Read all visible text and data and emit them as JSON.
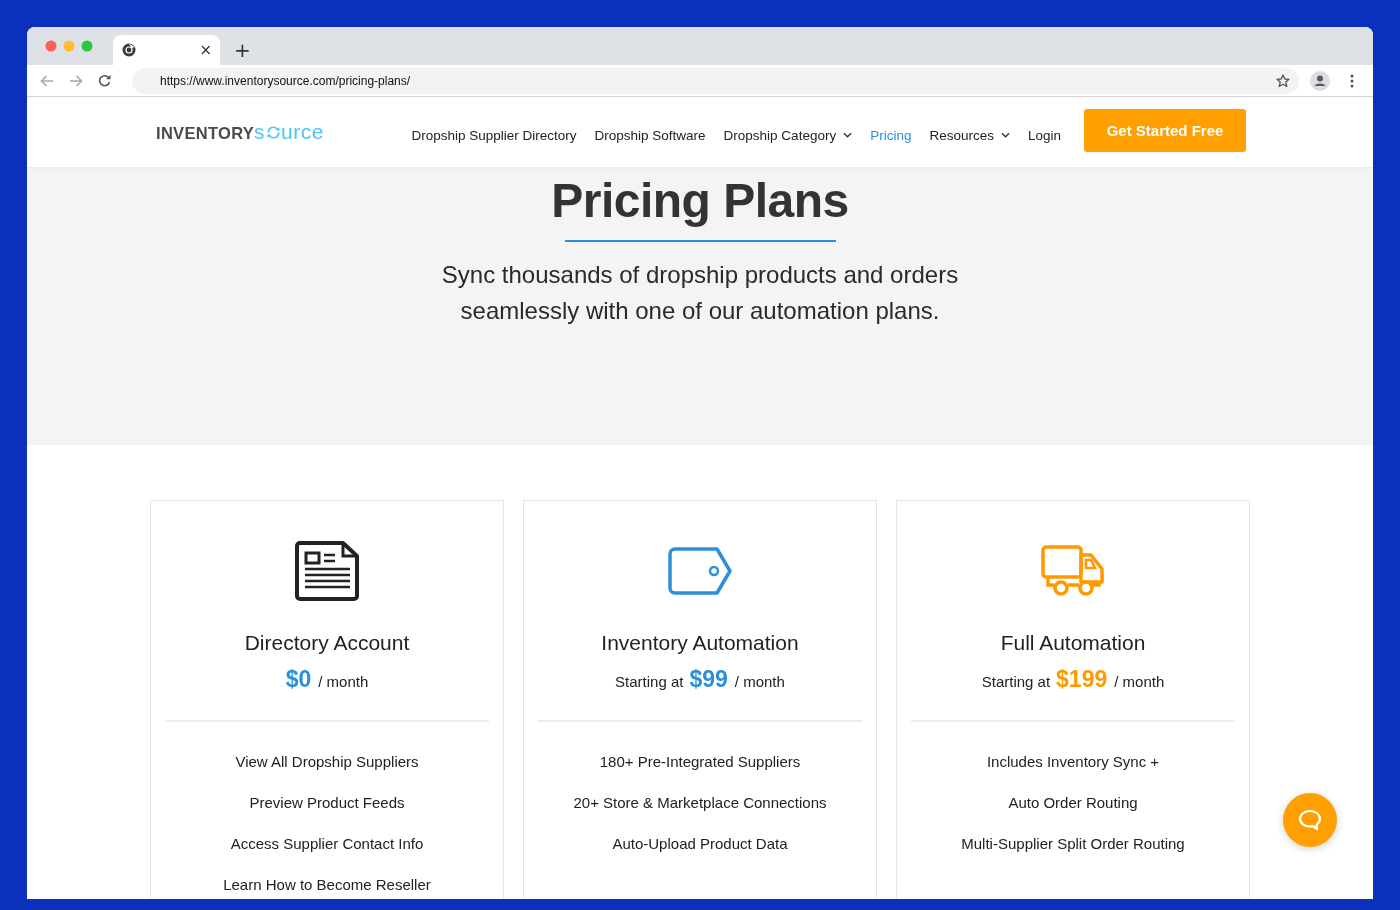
{
  "browser": {
    "tab": {
      "close": "×"
    },
    "new_tab": "+",
    "url": "https://www.inventorysource.com/pricing-plans/"
  },
  "header": {
    "logo": {
      "dark": "INVENTORY",
      "light_start": "s",
      "light_end": "urce"
    },
    "nav": [
      {
        "label": "Dropship Supplier Directory",
        "selected": false,
        "dropdown": false
      },
      {
        "label": "Dropship Software",
        "selected": false,
        "dropdown": false
      },
      {
        "label": "Dropship Category",
        "selected": false,
        "dropdown": true
      },
      {
        "label": "Pricing",
        "selected": true,
        "dropdown": false
      },
      {
        "label": "Resources",
        "selected": false,
        "dropdown": true
      },
      {
        "label": "Login",
        "selected": false,
        "dropdown": false
      }
    ],
    "cta": "Get Started Free"
  },
  "hero": {
    "title": "Pricing Plans",
    "subtitle": "Sync thousands of dropship products and orders seamlessly with one of our automation plans."
  },
  "plans": [
    {
      "icon": {
        "kind": "document",
        "color": "#222222"
      },
      "title": "Directory Account",
      "price": "$0",
      "color": "#2b90d9",
      "period": "/ month",
      "features": [
        "View All Dropship Suppliers",
        "Preview Product Feeds",
        "Access Supplier Contact Info",
        "Learn How to Become Reseller"
      ]
    },
    {
      "icon": {
        "kind": "tag",
        "color": "#2b90d9"
      },
      "title": "Inventory Automation",
      "prefix": "Starting at",
      "price": "$99",
      "color": "#2b90d9",
      "period": "/ month",
      "features": [
        "180+ Pre-Integrated Suppliers",
        "20+ Store & Marketplace Connections",
        "Auto-Upload Product Data"
      ]
    },
    {
      "icon": {
        "kind": "truck",
        "color": "#ff9900"
      },
      "title": "Full Automation",
      "prefix": "Starting at",
      "price": "$199",
      "color": "#ff9900",
      "period": "/ month",
      "features": [
        "Includes Inventory Sync +",
        "Auto Order Routing",
        "Multi-Supplier Split Order Routing"
      ]
    }
  ]
}
